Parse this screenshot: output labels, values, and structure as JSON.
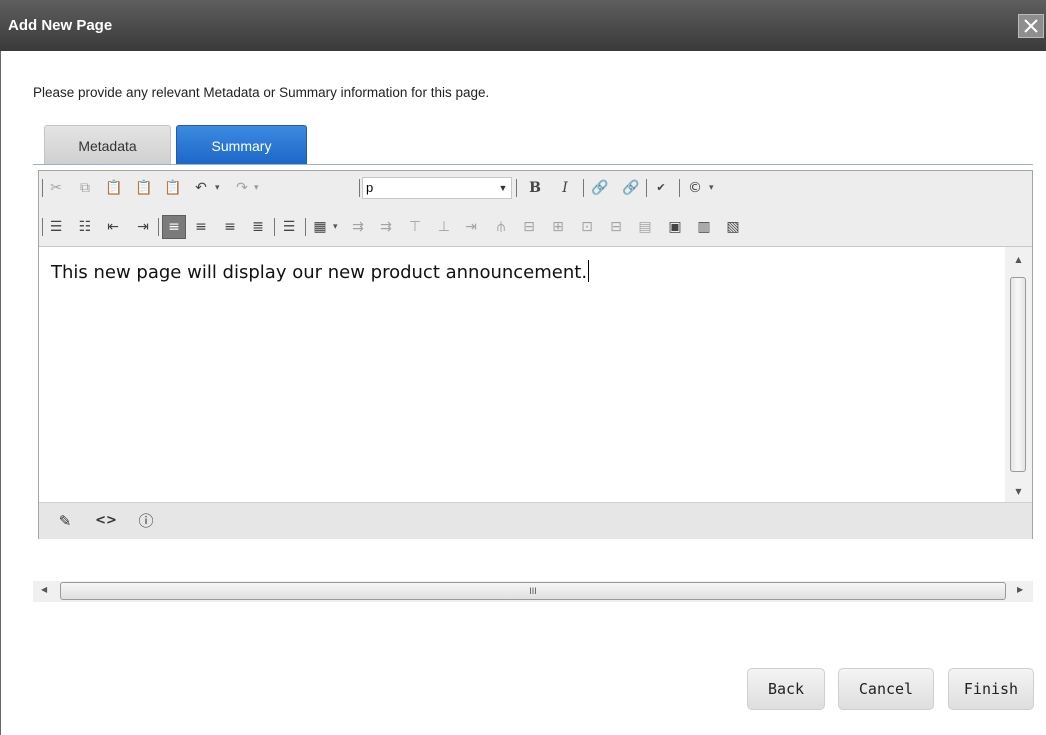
{
  "dialog": {
    "title": "Add New Page",
    "close_icon": "close-icon"
  },
  "prompt": "Please provide any relevant Metadata or Summary information for this page.",
  "tabs": [
    {
      "label": "Metadata",
      "active": false
    },
    {
      "label": "Summary",
      "active": true
    }
  ],
  "toolbar": {
    "format_select": "p",
    "row1_icons": [
      "cut-icon",
      "copy-icon",
      "paste-icon",
      "paste-from-word-icon",
      "paste-plain-text-icon",
      "undo-icon",
      "redo-icon",
      "bold-icon",
      "italic-icon",
      "insert-link-icon",
      "remove-link-icon",
      "spellcheck-icon",
      "copyright-symbol-icon"
    ],
    "row2_icons": [
      "ordered-list-icon",
      "unordered-list-icon",
      "outdent-icon",
      "indent-icon",
      "align-left-icon",
      "align-center-icon",
      "align-right-icon",
      "justify-icon",
      "line-spacing-icon",
      "table-icon",
      "insert-column-before-icon",
      "insert-column-after-icon",
      "insert-row-before-icon",
      "insert-row-after-icon",
      "merge-right-icon",
      "split-cell-icon",
      "delete-row-icon",
      "delete-column-icon",
      "delete-cell-icon",
      "merge-cells-icon",
      "table-properties-icon",
      "cell-properties-icon",
      "table-wizard-icon"
    ]
  },
  "editor": {
    "content": "This new page will display our new product announcement."
  },
  "modes": [
    "design-mode-icon",
    "html-mode-icon",
    "preview-mode-icon"
  ],
  "horizontal_scroll": {
    "thumb_label": "III"
  },
  "buttons": {
    "back": "Back",
    "cancel": "Cancel",
    "finish": "Finish"
  },
  "colors": {
    "titlebar": "#444444",
    "active_tab": "#1c66c8"
  }
}
